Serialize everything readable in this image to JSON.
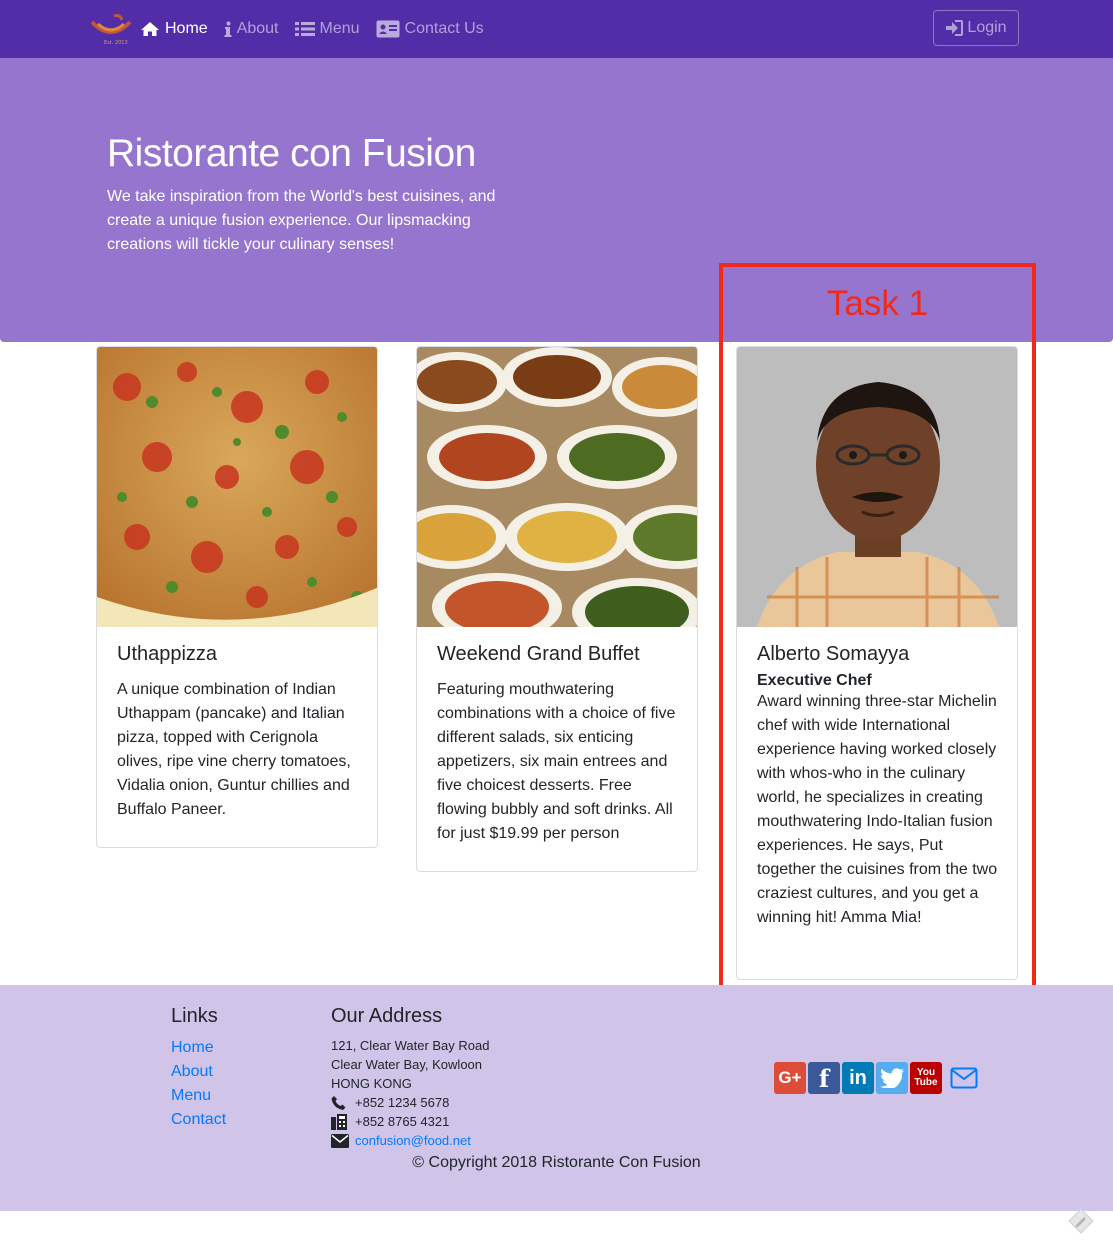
{
  "nav": {
    "items": [
      {
        "label": "Home",
        "icon": "home-icon"
      },
      {
        "label": "About",
        "icon": "info-icon"
      },
      {
        "label": "Menu",
        "icon": "list-icon"
      },
      {
        "label": "Contact Us",
        "icon": "address-card-icon"
      }
    ],
    "login_label": "Login"
  },
  "jumbotron": {
    "title": "Ristorante con Fusion",
    "text": "We take inspiration from the World's best cuisines, and create a unique fusion experience. Our lipsmacking creations will tickle your culinary senses!"
  },
  "annotation": {
    "label": "Task 1",
    "color": "#ee2a1d"
  },
  "cards": [
    {
      "title": "Uthappizza",
      "text": "A unique combination of Indian Uthappam (pancake) and Italian pizza, topped with Cerignola olives, ripe vine cherry tomatoes, Vidalia onion, Guntur chillies and Buffalo Paneer."
    },
    {
      "title": "Weekend Grand Buffet",
      "text": "Featuring mouthwatering combinations with a choice of five different salads, six enticing appetizers, six main entrees and five choicest desserts. Free flowing bubbly and soft drinks. All for just $19.99 per person"
    },
    {
      "title": "Alberto Somayya",
      "subtitle": "Executive Chef",
      "text": "Award winning three-star Michelin chef with wide International experience having worked closely with whos-who in the culinary world, he specializes in creating mouthwatering Indo-Italian fusion experiences. He says, Put together the cuisines from the two craziest cultures, and you get a winning hit! Amma Mia!"
    }
  ],
  "footer": {
    "links_title": "Links",
    "links": [
      "Home",
      "About",
      "Menu",
      "Contact"
    ],
    "address_title": "Our Address",
    "address_lines": [
      "121, Clear Water Bay Road",
      "Clear Water Bay, Kowloon",
      "HONG KONG"
    ],
    "phone": "+852 1234 5678",
    "fax": "+852 8765 4321",
    "email": "confusion@food.net",
    "social": [
      {
        "name": "google-plus",
        "glyph": "G+",
        "color": "#dd4b39"
      },
      {
        "name": "facebook",
        "glyph": "f",
        "color": "#3b5998"
      },
      {
        "name": "linkedin",
        "glyph": "in",
        "color": "#007bb6"
      },
      {
        "name": "twitter",
        "glyph": "t",
        "color": "#55acee"
      },
      {
        "name": "youtube",
        "glyph": "You Tube",
        "color": "#bb0000"
      }
    ],
    "copyright": "© Copyright 2018 Ristorante Con Fusion"
  },
  "colors": {
    "navbar": "#512da8",
    "jumbotron": "#9575cd",
    "footer": "#d1c4e9",
    "link": "#007bff"
  }
}
